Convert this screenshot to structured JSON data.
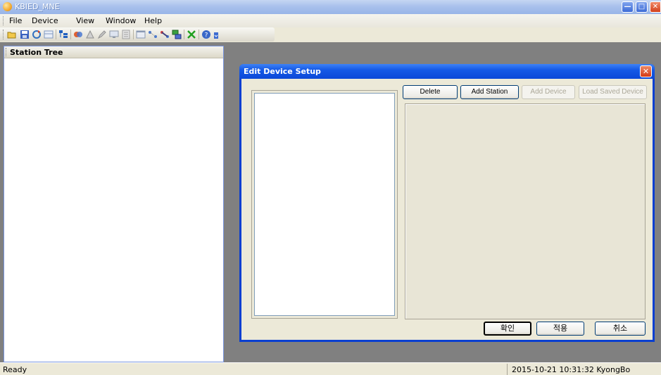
{
  "window": {
    "title": "KBIED_MNE"
  },
  "menu": [
    {
      "label": "File"
    },
    {
      "label": "Device"
    },
    {
      "label": "View"
    },
    {
      "label": "Window"
    },
    {
      "label": "Help"
    }
  ],
  "toolbar": {
    "icons": [
      "open-icon",
      "save-icon",
      "refresh-icon",
      "table-icon",
      "tree-icon",
      "merge-icon",
      "connect-icon",
      "edit-icon",
      "monitor-icon",
      "list-icon",
      "window-icon",
      "link-icon",
      "link2-icon",
      "network-icon",
      "delete-x-icon",
      "help-icon",
      "overflow-icon"
    ]
  },
  "station_tree": {
    "title": "Station Tree"
  },
  "dialog": {
    "title": "Edit Device Setup",
    "buttons": {
      "delete": "Delete",
      "add_station": "Add Station",
      "add_device": "Add Device",
      "load_saved_device": "Load Saved Device",
      "ok": "확인",
      "apply": "적용",
      "cancel": "취소"
    }
  },
  "statusbar": {
    "left": "Ready",
    "right": "2015-10-21 10:31:32  KyongBo"
  }
}
